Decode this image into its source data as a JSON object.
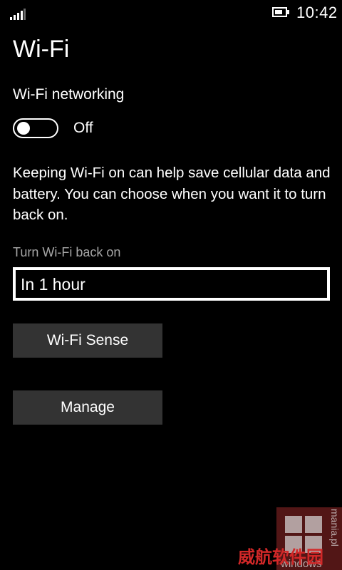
{
  "status_bar": {
    "time": "10:42",
    "signal_icon": "signal-bars-icon",
    "battery_icon": "battery-icon"
  },
  "page": {
    "title": "Wi-Fi"
  },
  "wifi_networking": {
    "label": "Wi-Fi networking",
    "state_label": "Off",
    "enabled": false
  },
  "description": "Keeping Wi-Fi on can help save cellular data and battery. You can choose when you want it to turn back on.",
  "turn_back_on": {
    "label": "Turn Wi-Fi back on",
    "selected_value": "In 1 hour"
  },
  "buttons": {
    "wifi_sense": "Wi-Fi Sense",
    "manage": "Manage"
  },
  "watermark": {
    "side_text": "mania.pl",
    "bottom_text": "windows",
    "site_text": "威航软件园"
  },
  "colors": {
    "background": "#000000",
    "text": "#ffffff",
    "secondary_text": "#a6a6a6",
    "button": "#333333",
    "watermark_red": "#d22828"
  }
}
